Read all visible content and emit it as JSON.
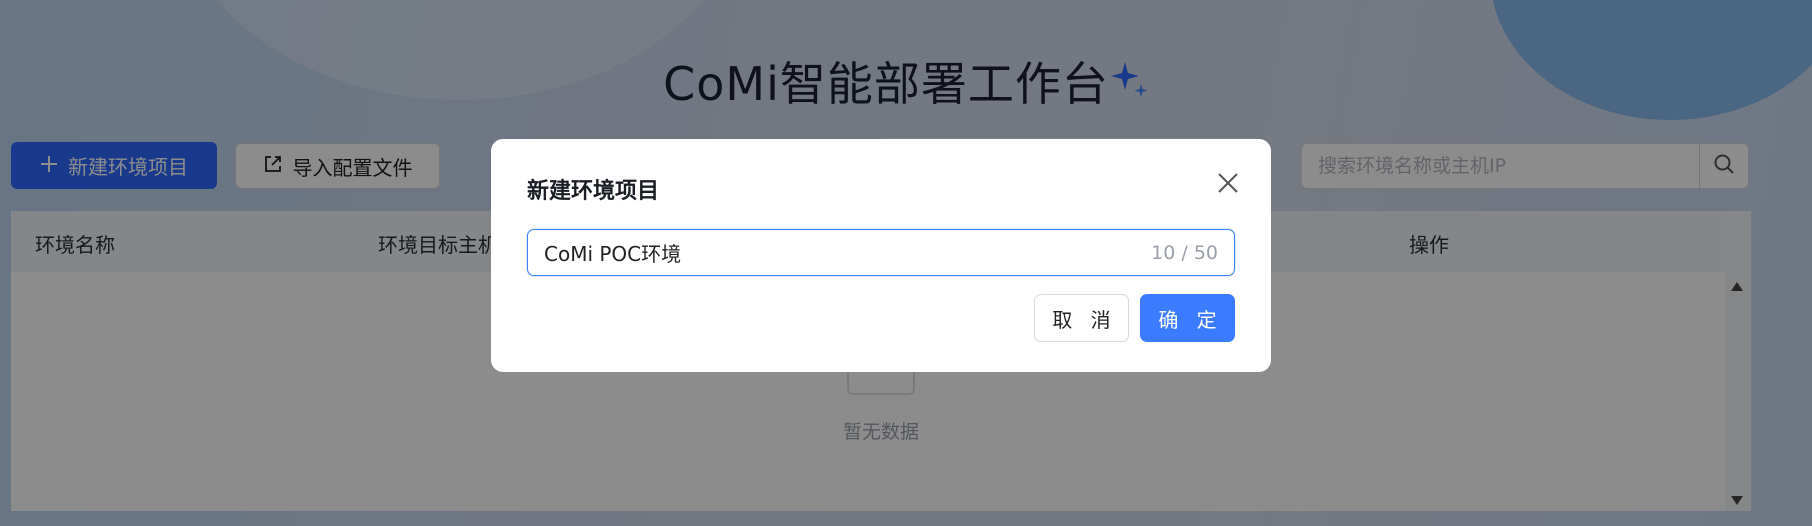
{
  "app": {
    "title": "CoMi智能部署工作台"
  },
  "toolbar": {
    "new_button_label": "新建环境项目",
    "import_button_label": "导入配置文件",
    "search_placeholder": "搜索环境名称或主机IP"
  },
  "table": {
    "columns": [
      "环境名称",
      "环境目标主机",
      "操作"
    ],
    "empty_text": "暂无数据"
  },
  "modal": {
    "title": "新建环境项目",
    "input_value": "CoMi POC环境",
    "char_count": "10 / 50",
    "cancel_label": "取 消",
    "confirm_label": "确 定"
  },
  "colors": {
    "primary": "#3b7bff",
    "overlay": "rgba(0,0,0,0.45)"
  },
  "icons": {
    "plus": "plus-icon",
    "import": "import-file-icon",
    "search": "search-icon",
    "close": "close-icon",
    "sparkle": "sparkle-icon"
  }
}
